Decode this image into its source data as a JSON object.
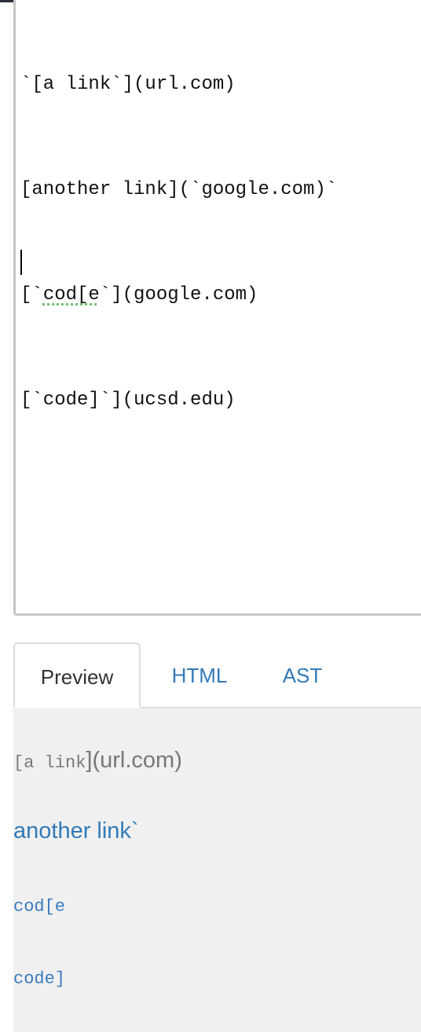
{
  "editor": {
    "lines": [
      "`[a link`](url.com)",
      "[another link](`google.com)`",
      "[`",
      "cod[e",
      "`](google.com)",
      "[`code]`](ucsd.edu)"
    ]
  },
  "tabs": [
    {
      "label": "Preview",
      "active": true
    },
    {
      "label": "HTML",
      "active": false
    },
    {
      "label": "AST",
      "active": false
    }
  ],
  "preview": {
    "line1_code": "[a link",
    "line1_text": "](url.com)",
    "line2_link": "another link`",
    "line3_code_link": "cod[e",
    "line4_code_link": "code]"
  },
  "colors": {
    "link": "#337ab7",
    "preview_bg": "#f0f0f0",
    "editor_border": "#c6c6c6",
    "spellcheck": "#6ec26e"
  }
}
